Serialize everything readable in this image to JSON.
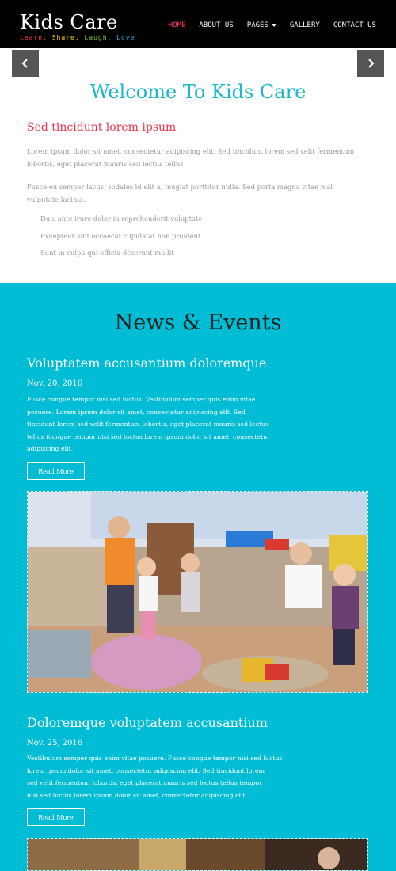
{
  "header": {
    "logo": "Kids Care",
    "tagline": [
      {
        "text": "Learn.",
        "color": "#ff3b5c"
      },
      {
        "text": " Share.",
        "color": "#ffd400"
      },
      {
        "text": " Laugh.",
        "color": "#7ac943"
      },
      {
        "text": " Love",
        "color": "#29abe2"
      }
    ],
    "nav": [
      {
        "label": "HOME",
        "active": true
      },
      {
        "label": "ABOUT US"
      },
      {
        "label": "PAGES"
      },
      {
        "label": "GALLERY"
      },
      {
        "label": "CONTACT US"
      }
    ]
  },
  "slider": {
    "prev_icon": "chevron-left-icon",
    "next_icon": "chevron-right-icon"
  },
  "welcome": {
    "title": "Welcome To Kids Care",
    "subtitle": "Sed tincidunt lorem ipsum",
    "para1_line1": "Lorem ipsum dolor sit amet, consectetur adipiscing elit. Sed tincidunt lorem sed velit fermentum",
    "para1_line2": "lobortis, eget placerat mauris sed lectus tellus",
    "para2_line1": "Fusce eu semper lacus, sodales id elit a, feugiat porttitor nulla. Sed porta magna vitae nisl",
    "para2_line2": "vulputate lacinia.",
    "bullets": [
      "Duis aute irure dolor in reprehenderit voluptate",
      "Excepteur sint occaecat cupidatat non proident",
      "Sunt in culpa qui officia deserunt mollit"
    ]
  },
  "news": {
    "title": "News & Events",
    "items": [
      {
        "title": "Voluptatem accusantium doloremque",
        "date": "Nov. 20, 2016",
        "body": [
          "Fusce congue tempor nisi sed luctus. Vestibulum semper quis enim vitae",
          "posuere. Lorem ipsum dolor sit amet, consectetur adipiscing elit. Sed",
          "tincidunt lorem sed velit fermentum lobortis, eget placerat mauris sed lectus",
          "tellus fcongue tempor nisi sed luctus lorem ipsum dolor sit amet, consectetur",
          "adipiscing elit."
        ],
        "button": "Read More"
      },
      {
        "title": "Doloremque voluptatem accusantium",
        "date": "Nov. 25, 2016",
        "body": [
          "Vestibulum semper quis enim vitae posuere. Fusce congue tempor nisi sed luctus",
          "lorem ipsum dolor sit amet, consectetur adipiscing elit. Sed tincidunt lorem",
          "sed velit fermentum lobortis, eget placerat mauris sed lectus tellus tempor",
          "nisi sed luctus lorem ipsum dolor sit amet, consectetur adipiscing elit."
        ],
        "button": "Read More"
      }
    ]
  },
  "colors": {
    "accent": "#19b6d0",
    "news_bg": "#00bcd4",
    "highlight": "#e8354f",
    "header_bg": "#000000"
  }
}
